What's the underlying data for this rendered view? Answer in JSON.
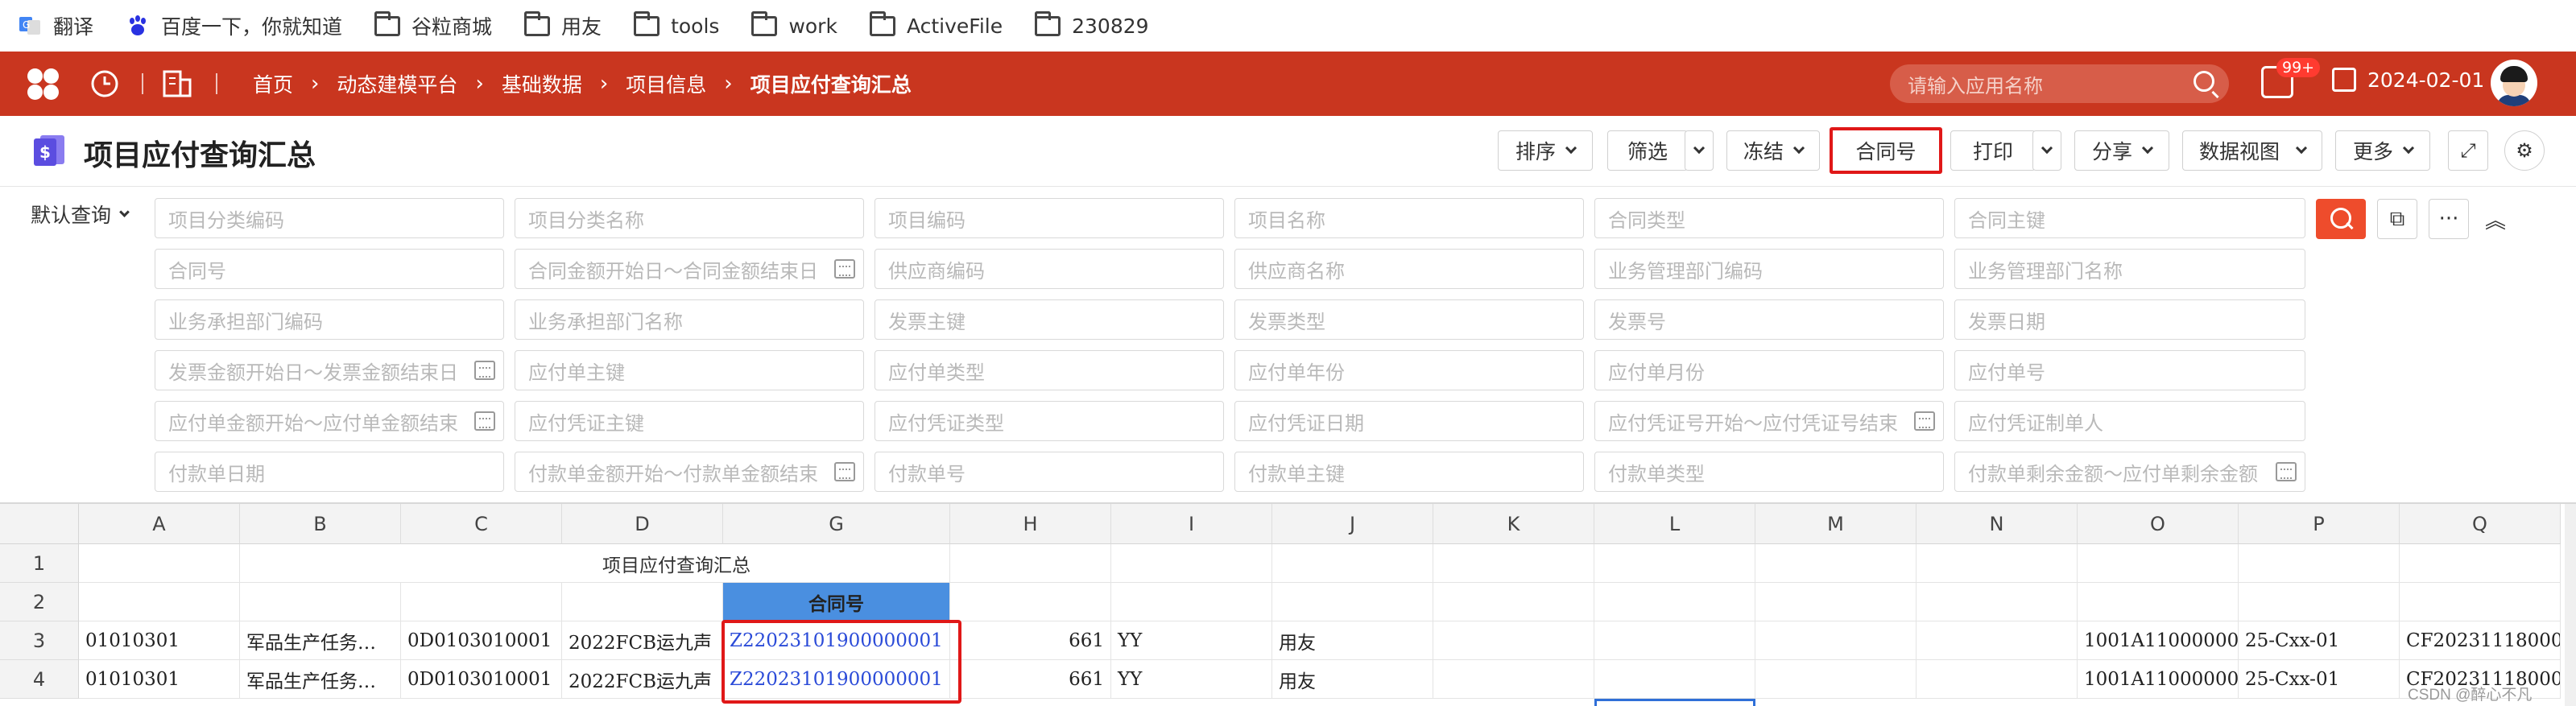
{
  "bookmarks": {
    "translate": "翻译",
    "baidu": "百度一下，你就知道",
    "folders": [
      "谷粒商城",
      "用友",
      "tools",
      "work",
      "ActiveFile",
      "230829"
    ]
  },
  "header": {
    "breadcrumbs": [
      "首页",
      "动态建模平台",
      "基础数据",
      "项目信息",
      "项目应付查询汇总"
    ],
    "search_placeholder": "请输入应用名称",
    "badge": "99+",
    "date": "2024-02-01"
  },
  "titlebar": {
    "title": "项目应付查询汇总",
    "sort": "排序",
    "filter": "筛选",
    "freeze": "冻结",
    "contract": "合同号",
    "print": "打印",
    "share": "分享",
    "dataview": "数据视图",
    "more": "更多"
  },
  "query": {
    "default_label": "默认查询",
    "rows": [
      [
        "项目分类编码",
        "项目分类名称",
        "项目编码",
        "项目名称",
        "合同类型",
        "合同主键"
      ],
      [
        "合同号",
        "合同金额开始日～合同金额结束日",
        "供应商编码",
        "供应商名称",
        "业务管理部门编码",
        "业务管理部门名称"
      ],
      [
        "业务承担部门编码",
        "业务承担部门名称",
        "发票主键",
        "发票类型",
        "发票号",
        "发票日期"
      ],
      [
        "发票金额开始日～发票金额结束日",
        "应付单主键",
        "应付单类型",
        "应付单年份",
        "应付单月份",
        "应付单号"
      ],
      [
        "应付单金额开始～应付单金额结束",
        "应付凭证主键",
        "应付凭证类型",
        "应付凭证日期",
        "应付凭证号开始～应付凭证号结束",
        "应付凭证制单人"
      ],
      [
        "付款单日期",
        "付款单金额开始～付款单金额结束",
        "付款单号",
        "付款单主键",
        "付款单类型",
        "付款单剩余金额～应付单剩余金额"
      ]
    ]
  },
  "sheet": {
    "columns": [
      "A",
      "B",
      "C",
      "D",
      "G",
      "H",
      "I",
      "J",
      "K",
      "L",
      "M",
      "N",
      "O",
      "P",
      "Q"
    ],
    "row_numbers": [
      "1",
      "2",
      "3",
      "4"
    ],
    "sheet_title": "项目应付查询汇总",
    "header_cell": "合同号",
    "rows": [
      [
        "01010301",
        "军品生产任务…",
        "0D0103010001",
        "2022FCB运九声",
        "Z22023101900000001",
        "661",
        "YY",
        "用友",
        "",
        "",
        "",
        "",
        "1001A11000000…",
        "25-Cxx-01",
        "CF20231118000…"
      ],
      [
        "01010301",
        "军品生产任务…",
        "0D0103010001",
        "2022FCB运九声",
        "Z22023101900000001",
        "661",
        "YY",
        "用友",
        "",
        "",
        "",
        "",
        "1001A11000000…",
        "25-Cxx-01",
        "CF20231118000…"
      ]
    ]
  },
  "watermark": "CSDN @醉心不凡"
}
